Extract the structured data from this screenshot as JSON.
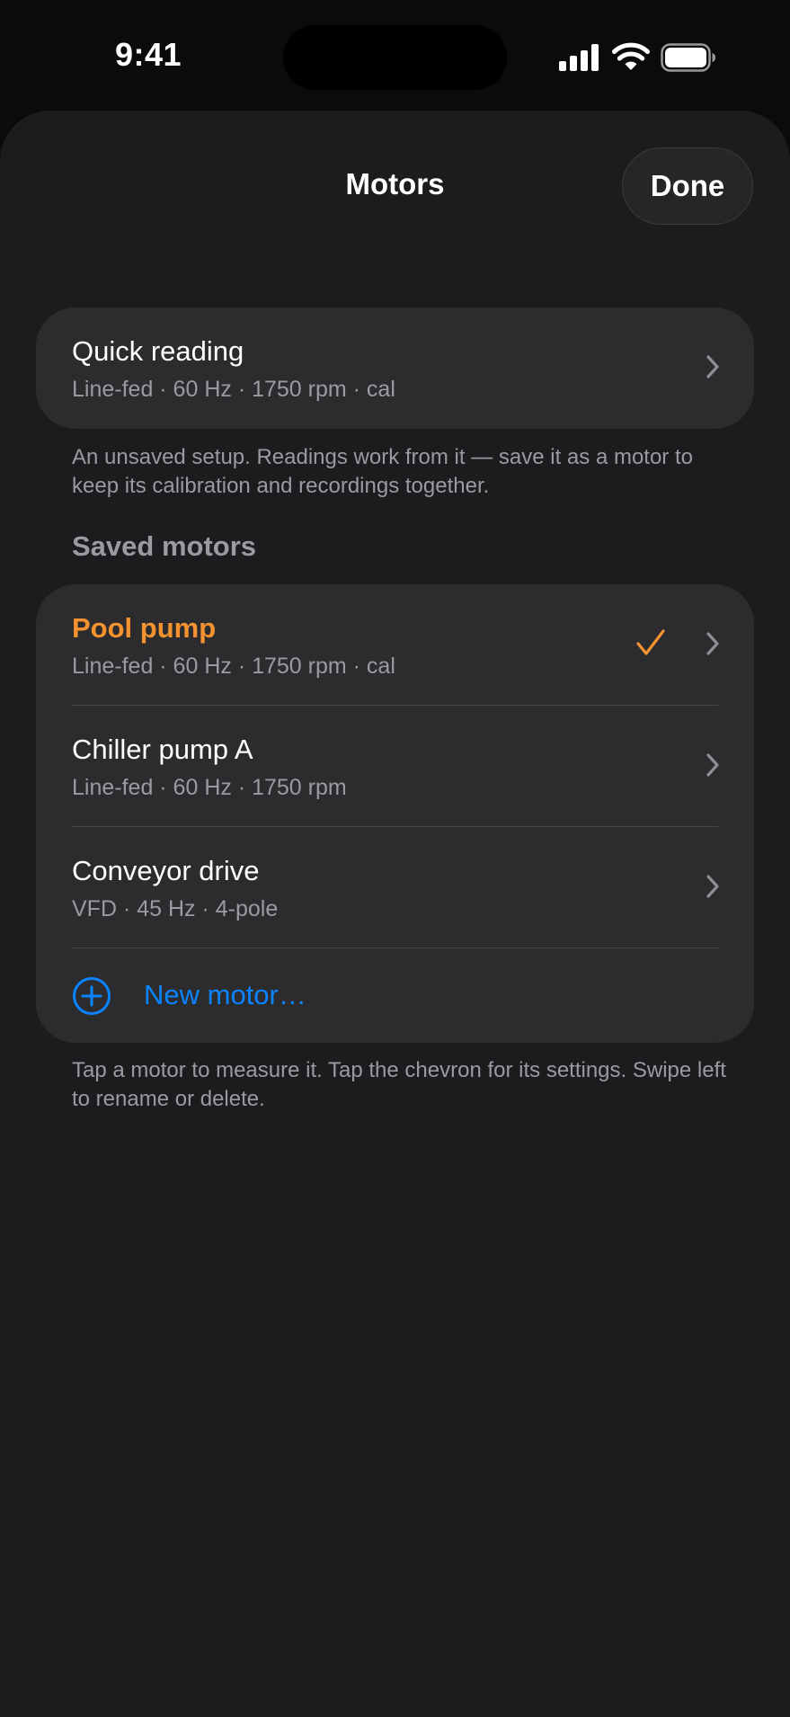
{
  "status_bar": {
    "time": "9:41"
  },
  "nav": {
    "title": "Motors",
    "done_label": "Done"
  },
  "quick_reading": {
    "title": "Quick reading",
    "subtitle": "Line-fed · 60 Hz · 1750 rpm · cal",
    "footnote": "An unsaved setup. Readings work from it — save it as a motor to keep its calibration and recordings together."
  },
  "saved": {
    "header": "Saved motors",
    "motors": [
      {
        "title": "Pool pump",
        "subtitle": "Line-fed · 60 Hz · 1750 rpm · cal",
        "selected": true
      },
      {
        "title": "Chiller pump A",
        "subtitle": "Line-fed · 60 Hz · 1750 rpm",
        "selected": false
      },
      {
        "title": "Conveyor drive",
        "subtitle": "VFD · 45 Hz · 4-pole",
        "selected": false
      }
    ],
    "new_label": "New motor…",
    "footnote": "Tap a motor to measure it. Tap the chevron for its settings. Swipe left to rename or delete."
  },
  "colors": {
    "accent_orange": "#f4922f",
    "link_blue": "#0a84ff",
    "sheet_bg": "#1c1c1e",
    "card_bg": "#2c2c2e",
    "secondary_text": "#9a9aa0"
  }
}
